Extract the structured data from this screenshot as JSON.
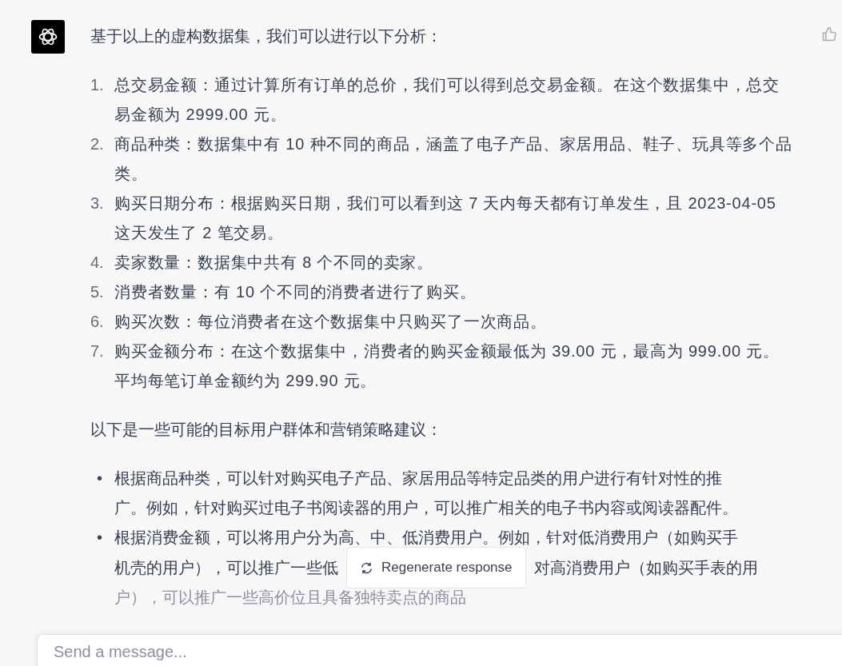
{
  "message": {
    "intro": "基于以上的虚构数据集，我们可以进行以下分析：",
    "analysis": [
      {
        "number": "1.",
        "text": "总交易金额：通过计算所有订单的总价，我们可以得到总交易金额。在这个数据集中，总交易金额为 2999.00 元。"
      },
      {
        "number": "2.",
        "text": "商品种类：数据集中有 10 种不同的商品，涵盖了电子产品、家居用品、鞋子、玩具等多个品类。"
      },
      {
        "number": "3.",
        "text": "购买日期分布：根据购买日期，我们可以看到这 7 天内每天都有订单发生，且 2023-04-05 这天发生了 2 笔交易。"
      },
      {
        "number": "4.",
        "text": "卖家数量：数据集中共有 8 个不同的卖家。"
      },
      {
        "number": "5.",
        "text": "消费者数量：有 10 个不同的消费者进行了购买。"
      },
      {
        "number": "6.",
        "text": "购买次数：每位消费者在这个数据集中只购买了一次商品。"
      },
      {
        "number": "7.",
        "text": "购买金额分布：在这个数据集中，消费者的购买金额最低为 39.00 元，最高为 999.00 元。平均每笔订单金额约为 299.90 元。"
      }
    ],
    "strategy_intro": "以下是一些可能的目标用户群体和营销策略建议：",
    "suggestions": [
      {
        "bullet": "•",
        "lines": [
          [
            "根据商品种类，可以针对购买电子产品、家居用品等特定品类的用户进行有针对性的推"
          ],
          [
            "广。例如，针对购买过电子书阅读器的用户，可以推广相关的电子书内容或阅读器配件。"
          ]
        ]
      },
      {
        "bullet": "•",
        "lines": [
          [
            "根据消费金额，可以将用户分为高、中、低消费用户。例如，针对低消费用户（如购买手"
          ],
          [
            "机壳的用户），可以推广一些低",
            "对高消费用户（如购买手表的用"
          ],
          [
            "户），可以推广一些高价位且具备独特卖点的商品"
          ]
        ]
      }
    ]
  },
  "regenerate_button": {
    "label": "Regenerate response"
  },
  "composer": {
    "placeholder": "Send a message..."
  }
}
